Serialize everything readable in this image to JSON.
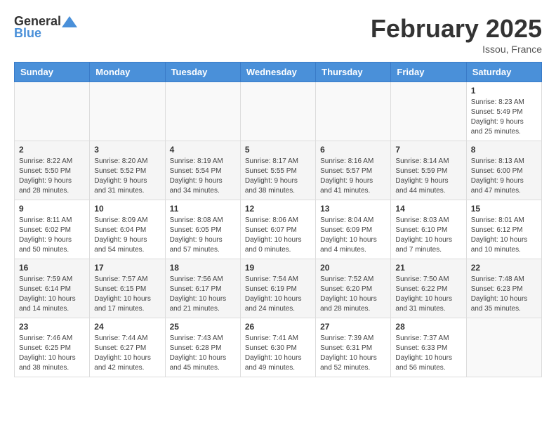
{
  "header": {
    "logo_general": "General",
    "logo_blue": "Blue",
    "month_title": "February 2025",
    "location": "Issou, France"
  },
  "weekdays": [
    "Sunday",
    "Monday",
    "Tuesday",
    "Wednesday",
    "Thursday",
    "Friday",
    "Saturday"
  ],
  "weeks": [
    [
      {
        "day": "",
        "info": ""
      },
      {
        "day": "",
        "info": ""
      },
      {
        "day": "",
        "info": ""
      },
      {
        "day": "",
        "info": ""
      },
      {
        "day": "",
        "info": ""
      },
      {
        "day": "",
        "info": ""
      },
      {
        "day": "1",
        "info": "Sunrise: 8:23 AM\nSunset: 5:49 PM\nDaylight: 9 hours and 25 minutes."
      }
    ],
    [
      {
        "day": "2",
        "info": "Sunrise: 8:22 AM\nSunset: 5:50 PM\nDaylight: 9 hours and 28 minutes."
      },
      {
        "day": "3",
        "info": "Sunrise: 8:20 AM\nSunset: 5:52 PM\nDaylight: 9 hours and 31 minutes."
      },
      {
        "day": "4",
        "info": "Sunrise: 8:19 AM\nSunset: 5:54 PM\nDaylight: 9 hours and 34 minutes."
      },
      {
        "day": "5",
        "info": "Sunrise: 8:17 AM\nSunset: 5:55 PM\nDaylight: 9 hours and 38 minutes."
      },
      {
        "day": "6",
        "info": "Sunrise: 8:16 AM\nSunset: 5:57 PM\nDaylight: 9 hours and 41 minutes."
      },
      {
        "day": "7",
        "info": "Sunrise: 8:14 AM\nSunset: 5:59 PM\nDaylight: 9 hours and 44 minutes."
      },
      {
        "day": "8",
        "info": "Sunrise: 8:13 AM\nSunset: 6:00 PM\nDaylight: 9 hours and 47 minutes."
      }
    ],
    [
      {
        "day": "9",
        "info": "Sunrise: 8:11 AM\nSunset: 6:02 PM\nDaylight: 9 hours and 50 minutes."
      },
      {
        "day": "10",
        "info": "Sunrise: 8:09 AM\nSunset: 6:04 PM\nDaylight: 9 hours and 54 minutes."
      },
      {
        "day": "11",
        "info": "Sunrise: 8:08 AM\nSunset: 6:05 PM\nDaylight: 9 hours and 57 minutes."
      },
      {
        "day": "12",
        "info": "Sunrise: 8:06 AM\nSunset: 6:07 PM\nDaylight: 10 hours and 0 minutes."
      },
      {
        "day": "13",
        "info": "Sunrise: 8:04 AM\nSunset: 6:09 PM\nDaylight: 10 hours and 4 minutes."
      },
      {
        "day": "14",
        "info": "Sunrise: 8:03 AM\nSunset: 6:10 PM\nDaylight: 10 hours and 7 minutes."
      },
      {
        "day": "15",
        "info": "Sunrise: 8:01 AM\nSunset: 6:12 PM\nDaylight: 10 hours and 10 minutes."
      }
    ],
    [
      {
        "day": "16",
        "info": "Sunrise: 7:59 AM\nSunset: 6:14 PM\nDaylight: 10 hours and 14 minutes."
      },
      {
        "day": "17",
        "info": "Sunrise: 7:57 AM\nSunset: 6:15 PM\nDaylight: 10 hours and 17 minutes."
      },
      {
        "day": "18",
        "info": "Sunrise: 7:56 AM\nSunset: 6:17 PM\nDaylight: 10 hours and 21 minutes."
      },
      {
        "day": "19",
        "info": "Sunrise: 7:54 AM\nSunset: 6:19 PM\nDaylight: 10 hours and 24 minutes."
      },
      {
        "day": "20",
        "info": "Sunrise: 7:52 AM\nSunset: 6:20 PM\nDaylight: 10 hours and 28 minutes."
      },
      {
        "day": "21",
        "info": "Sunrise: 7:50 AM\nSunset: 6:22 PM\nDaylight: 10 hours and 31 minutes."
      },
      {
        "day": "22",
        "info": "Sunrise: 7:48 AM\nSunset: 6:23 PM\nDaylight: 10 hours and 35 minutes."
      }
    ],
    [
      {
        "day": "23",
        "info": "Sunrise: 7:46 AM\nSunset: 6:25 PM\nDaylight: 10 hours and 38 minutes."
      },
      {
        "day": "24",
        "info": "Sunrise: 7:44 AM\nSunset: 6:27 PM\nDaylight: 10 hours and 42 minutes."
      },
      {
        "day": "25",
        "info": "Sunrise: 7:43 AM\nSunset: 6:28 PM\nDaylight: 10 hours and 45 minutes."
      },
      {
        "day": "26",
        "info": "Sunrise: 7:41 AM\nSunset: 6:30 PM\nDaylight: 10 hours and 49 minutes."
      },
      {
        "day": "27",
        "info": "Sunrise: 7:39 AM\nSunset: 6:31 PM\nDaylight: 10 hours and 52 minutes."
      },
      {
        "day": "28",
        "info": "Sunrise: 7:37 AM\nSunset: 6:33 PM\nDaylight: 10 hours and 56 minutes."
      },
      {
        "day": "",
        "info": ""
      }
    ]
  ]
}
